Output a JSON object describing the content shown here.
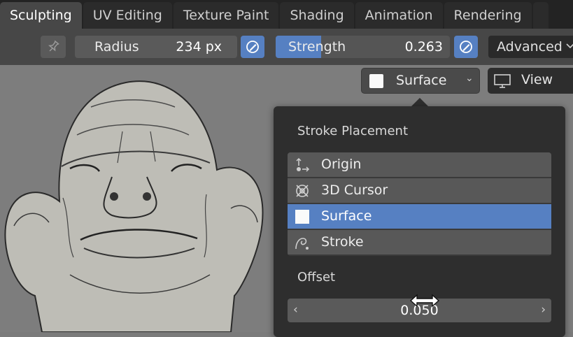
{
  "workspace_tabs": [
    {
      "label": "Sculpting",
      "active": true
    },
    {
      "label": "UV Editing",
      "active": false
    },
    {
      "label": "Texture Paint",
      "active": false
    },
    {
      "label": "Shading",
      "active": false
    },
    {
      "label": "Animation",
      "active": false
    },
    {
      "label": "Rendering",
      "active": false
    }
  ],
  "toolbar": {
    "radius": {
      "label": "Radius",
      "value": "234 px"
    },
    "strength": {
      "label": "Strength",
      "value": "0.263",
      "fraction": 0.263
    },
    "advanced_label": "Advanced"
  },
  "viewport_header": {
    "stroke_method_label": "Surface",
    "view_label": "View"
  },
  "popover": {
    "title": "Stroke Placement",
    "options": [
      {
        "label": "Origin",
        "icon": "origin-icon",
        "selected": false
      },
      {
        "label": "3D Cursor",
        "icon": "3d-cursor-icon",
        "selected": false
      },
      {
        "label": "Surface",
        "icon": "surface-icon",
        "selected": true
      },
      {
        "label": "Stroke",
        "icon": "stroke-icon",
        "selected": false
      }
    ],
    "offset_label": "Offset",
    "offset_value": "0.050"
  },
  "colors": {
    "accent": "#5680c2",
    "header_bg": "#474747",
    "popover_bg": "#2e2e2e"
  }
}
